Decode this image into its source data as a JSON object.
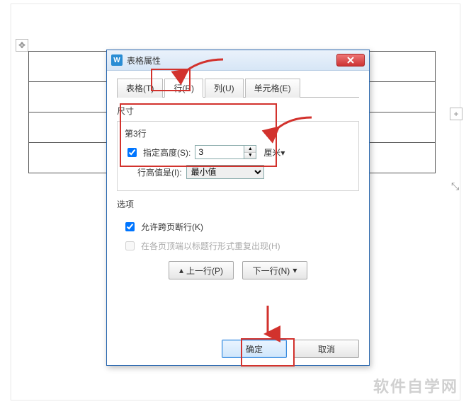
{
  "dialog": {
    "title": "表格属性",
    "tabs": {
      "table": "表格(T)",
      "row": "行(R)",
      "column": "列(U)",
      "cell": "单元格(E)"
    },
    "active_tab": "row",
    "size": {
      "legend": "尺寸",
      "row_label": "第3行",
      "specify_height_label": "指定高度(S):",
      "specify_height_checked": true,
      "height_value": "3",
      "unit": "厘米▾",
      "row_height_is_label": "行高值是(I):",
      "row_height_is_value": "最小值"
    },
    "options": {
      "legend": "选项",
      "allow_break_label": "允许跨页断行(K)",
      "allow_break_checked": true,
      "repeat_header_label": "在各页顶端以标题行形式重复出现(H)",
      "repeat_header_checked": false
    },
    "nav": {
      "prev": "上一行(P)",
      "next": "下一行(N)",
      "prev_arrow": "▴",
      "next_arrow": "▾"
    },
    "footer": {
      "ok": "确定",
      "cancel": "取消"
    }
  },
  "watermark": "软件自学网",
  "annotations": {
    "arrow_color": "#d2322d"
  }
}
